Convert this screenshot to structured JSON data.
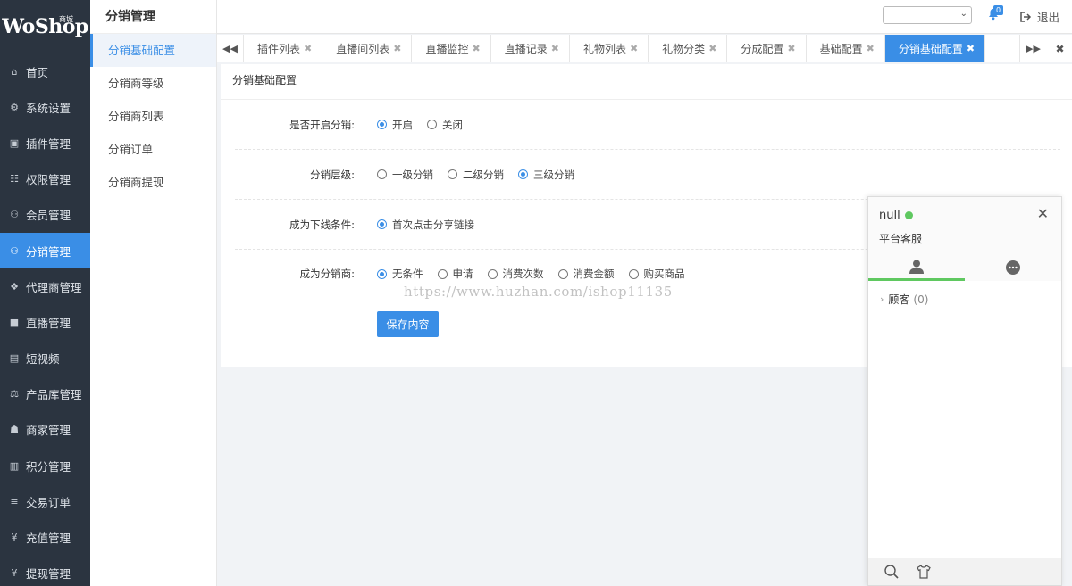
{
  "brand": {
    "logo": "WoShop",
    "badge": "商城"
  },
  "sidebar": {
    "items": [
      {
        "label": "首页",
        "icon": "home-icon"
      },
      {
        "label": "系统设置",
        "icon": "gear-icon"
      },
      {
        "label": "插件管理",
        "icon": "plugin-icon"
      },
      {
        "label": "权限管理",
        "icon": "sitemap-icon"
      },
      {
        "label": "会员管理",
        "icon": "users-icon"
      },
      {
        "label": "分销管理",
        "icon": "group-icon",
        "active": true
      },
      {
        "label": "代理商管理",
        "icon": "cubes-icon"
      },
      {
        "label": "直播管理",
        "icon": "video-icon"
      },
      {
        "label": "短视频",
        "icon": "film-icon"
      },
      {
        "label": "产品库管理",
        "icon": "scale-icon"
      },
      {
        "label": "商家管理",
        "icon": "bank-icon"
      },
      {
        "label": "积分管理",
        "icon": "file-icon"
      },
      {
        "label": "交易订单",
        "icon": "order-icon"
      },
      {
        "label": "充值管理",
        "icon": "yen-icon"
      },
      {
        "label": "提现管理",
        "icon": "yen-icon"
      }
    ]
  },
  "submenu": {
    "title": "分销管理",
    "items": [
      {
        "label": "分销基础配置",
        "active": true
      },
      {
        "label": "分销商等级"
      },
      {
        "label": "分销商列表"
      },
      {
        "label": "分销订单"
      },
      {
        "label": "分销商提现"
      }
    ]
  },
  "header": {
    "notification_count": "0",
    "logout": "退出",
    "select_value": ""
  },
  "tabs": [
    "插件列表",
    "直播间列表",
    "直播监控",
    "直播记录",
    "礼物列表",
    "礼物分类",
    "分成配置",
    "基础配置",
    "分销基础配置"
  ],
  "active_tab": "分销基础配置",
  "panel": {
    "title": "分销基础配置",
    "rows": [
      {
        "label": "是否开启分销:",
        "options": [
          "开启",
          "关闭"
        ],
        "selected": 0
      },
      {
        "label": "分销层级:",
        "options": [
          "一级分销",
          "二级分销",
          "三级分销"
        ],
        "selected": 2
      },
      {
        "label": "成为下线条件:",
        "options": [
          "首次点击分享链接"
        ],
        "selected": 0
      },
      {
        "label": "成为分销商:",
        "options": [
          "无条件",
          "申请",
          "消费次数",
          "消费金额",
          "购买商品"
        ],
        "selected": 0
      }
    ],
    "save_label": "保存内容"
  },
  "watermark": "https://www.huzhan.com/ishop11135",
  "chat": {
    "name": "null",
    "subtitle": "平台客服",
    "group_label": "顾客",
    "group_count": "(0)"
  },
  "colors": {
    "accent": "#3a8ee6",
    "sidebar_bg": "#2b3440",
    "online": "#5fc860"
  }
}
